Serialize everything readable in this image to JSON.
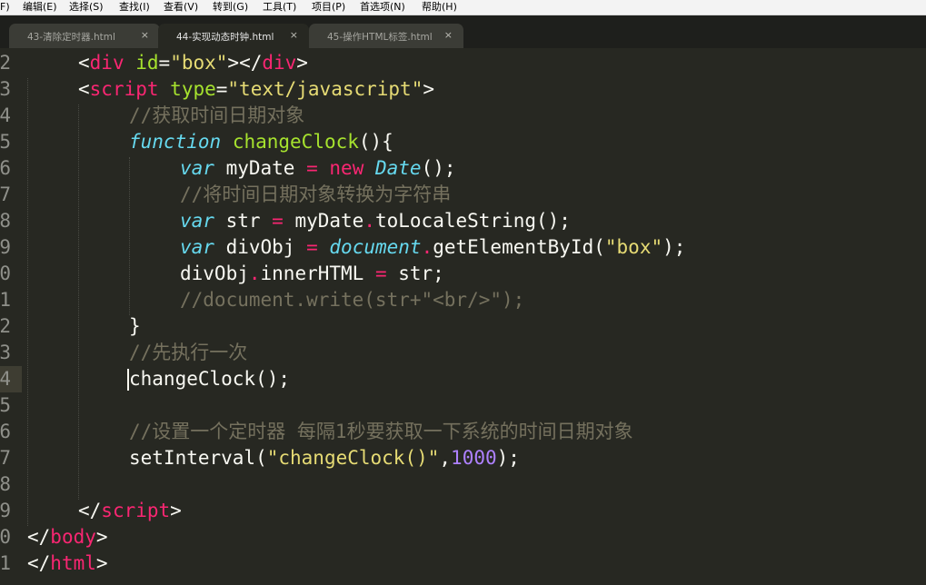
{
  "menu": {
    "items": [
      "F)",
      "编辑(E)",
      "选择(S)",
      "查找(I)",
      "查看(V)",
      "转到(G)",
      "工具(T)",
      "项目(P)",
      "首选项(N)",
      "帮助(H)"
    ]
  },
  "tabs": [
    {
      "label": "43-清除定时器.html",
      "close": "×",
      "active": false
    },
    {
      "label": "44-实现动态时钟.html",
      "close": "×",
      "active": true
    },
    {
      "label": "45-操作HTML标签.html",
      "close": "×",
      "active": false
    }
  ],
  "colors": {
    "background": "#272822",
    "tag": "#f92672",
    "attribute": "#a6e22e",
    "string": "#e6db74",
    "comment": "#75715e",
    "keyword": "#66d9ef",
    "number": "#ae81ff",
    "text": "#f8f8f2"
  },
  "editor": {
    "current_line": "4",
    "lines": [
      {
        "num": "2",
        "tokens": [
          {
            "t": "<",
            "c": "punc"
          },
          {
            "t": "div",
            "c": "tag"
          },
          {
            "t": " ",
            "c": "plain"
          },
          {
            "t": "id",
            "c": "attr"
          },
          {
            "t": "=",
            "c": "punc"
          },
          {
            "t": "\"box\"",
            "c": "str"
          },
          {
            "t": "></",
            "c": "punc"
          },
          {
            "t": "div",
            "c": "tag"
          },
          {
            "t": ">",
            "c": "punc"
          }
        ]
      },
      {
        "num": "3",
        "tokens": [
          {
            "t": "<",
            "c": "punc"
          },
          {
            "t": "script",
            "c": "tag"
          },
          {
            "t": " ",
            "c": "plain"
          },
          {
            "t": "type",
            "c": "attr"
          },
          {
            "t": "=",
            "c": "punc"
          },
          {
            "t": "\"text/javascript\"",
            "c": "str"
          },
          {
            "t": ">",
            "c": "punc"
          }
        ]
      },
      {
        "num": "4",
        "tokens": [
          {
            "t": "//获取时间日期对象",
            "c": "com"
          }
        ]
      },
      {
        "num": "5",
        "tokens": [
          {
            "t": "function",
            "c": "kw"
          },
          {
            "t": " ",
            "c": "plain"
          },
          {
            "t": "changeClock",
            "c": "fn"
          },
          {
            "t": "(){",
            "c": "punc"
          }
        ]
      },
      {
        "num": "6",
        "tokens": [
          {
            "t": "var",
            "c": "kw"
          },
          {
            "t": " myDate ",
            "c": "plain"
          },
          {
            "t": "=",
            "c": "op"
          },
          {
            "t": " ",
            "c": "plain"
          },
          {
            "t": "new",
            "c": "op"
          },
          {
            "t": " ",
            "c": "plain"
          },
          {
            "t": "Date",
            "c": "kw"
          },
          {
            "t": "();",
            "c": "punc"
          }
        ]
      },
      {
        "num": "7",
        "tokens": [
          {
            "t": "//将时间日期对象转换为字符串",
            "c": "com"
          }
        ]
      },
      {
        "num": "8",
        "tokens": [
          {
            "t": "var",
            "c": "kw"
          },
          {
            "t": " str ",
            "c": "plain"
          },
          {
            "t": "=",
            "c": "op"
          },
          {
            "t": " myDate",
            "c": "plain"
          },
          {
            "t": ".",
            "c": "op"
          },
          {
            "t": "toLocaleString",
            "c": "plain"
          },
          {
            "t": "();",
            "c": "punc"
          }
        ]
      },
      {
        "num": "9",
        "tokens": [
          {
            "t": "var",
            "c": "kw"
          },
          {
            "t": " divObj ",
            "c": "plain"
          },
          {
            "t": "=",
            "c": "op"
          },
          {
            "t": " ",
            "c": "plain"
          },
          {
            "t": "document",
            "c": "kw"
          },
          {
            "t": ".",
            "c": "op"
          },
          {
            "t": "getElementById",
            "c": "plain"
          },
          {
            "t": "(",
            "c": "punc"
          },
          {
            "t": "\"box\"",
            "c": "str"
          },
          {
            "t": ");",
            "c": "punc"
          }
        ]
      },
      {
        "num": "0",
        "tokens": [
          {
            "t": "divObj",
            "c": "plain"
          },
          {
            "t": ".",
            "c": "op"
          },
          {
            "t": "innerHTML ",
            "c": "plain"
          },
          {
            "t": "=",
            "c": "op"
          },
          {
            "t": " str;",
            "c": "plain"
          }
        ]
      },
      {
        "num": "1",
        "tokens": [
          {
            "t": "//document.write(str+\"<br/>\");",
            "c": "com"
          }
        ]
      },
      {
        "num": "2",
        "tokens": [
          {
            "t": "}",
            "c": "punc"
          }
        ]
      },
      {
        "num": "3",
        "tokens": [
          {
            "t": "//先执行一次",
            "c": "com"
          }
        ]
      },
      {
        "num": "4",
        "tokens": [
          {
            "t": "changeClock",
            "c": "plain"
          },
          {
            "t": "();",
            "c": "punc"
          }
        ]
      },
      {
        "num": "5",
        "tokens": []
      },
      {
        "num": "6",
        "tokens": [
          {
            "t": "//设置一个定时器 每隔1秒要获取一下系统的时间日期对象",
            "c": "com"
          }
        ]
      },
      {
        "num": "7",
        "tokens": [
          {
            "t": "setInterval",
            "c": "plain"
          },
          {
            "t": "(",
            "c": "punc"
          },
          {
            "t": "\"changeClock()\"",
            "c": "str"
          },
          {
            "t": ",",
            "c": "punc"
          },
          {
            "t": "1000",
            "c": "num"
          },
          {
            "t": ");",
            "c": "punc"
          }
        ]
      },
      {
        "num": "8",
        "tokens": []
      },
      {
        "num": "9",
        "tokens": [
          {
            "t": "</",
            "c": "punc"
          },
          {
            "t": "script",
            "c": "tag"
          },
          {
            "t": ">",
            "c": "punc"
          }
        ]
      },
      {
        "num": "0",
        "tokens": [
          {
            "t": "</",
            "c": "punc"
          },
          {
            "t": "body",
            "c": "tag"
          },
          {
            "t": ">",
            "c": "punc"
          }
        ]
      },
      {
        "num": "1",
        "tokens": [
          {
            "t": "</",
            "c": "punc"
          },
          {
            "t": "html",
            "c": "tag"
          },
          {
            "t": ">",
            "c": "punc"
          }
        ]
      }
    ]
  }
}
